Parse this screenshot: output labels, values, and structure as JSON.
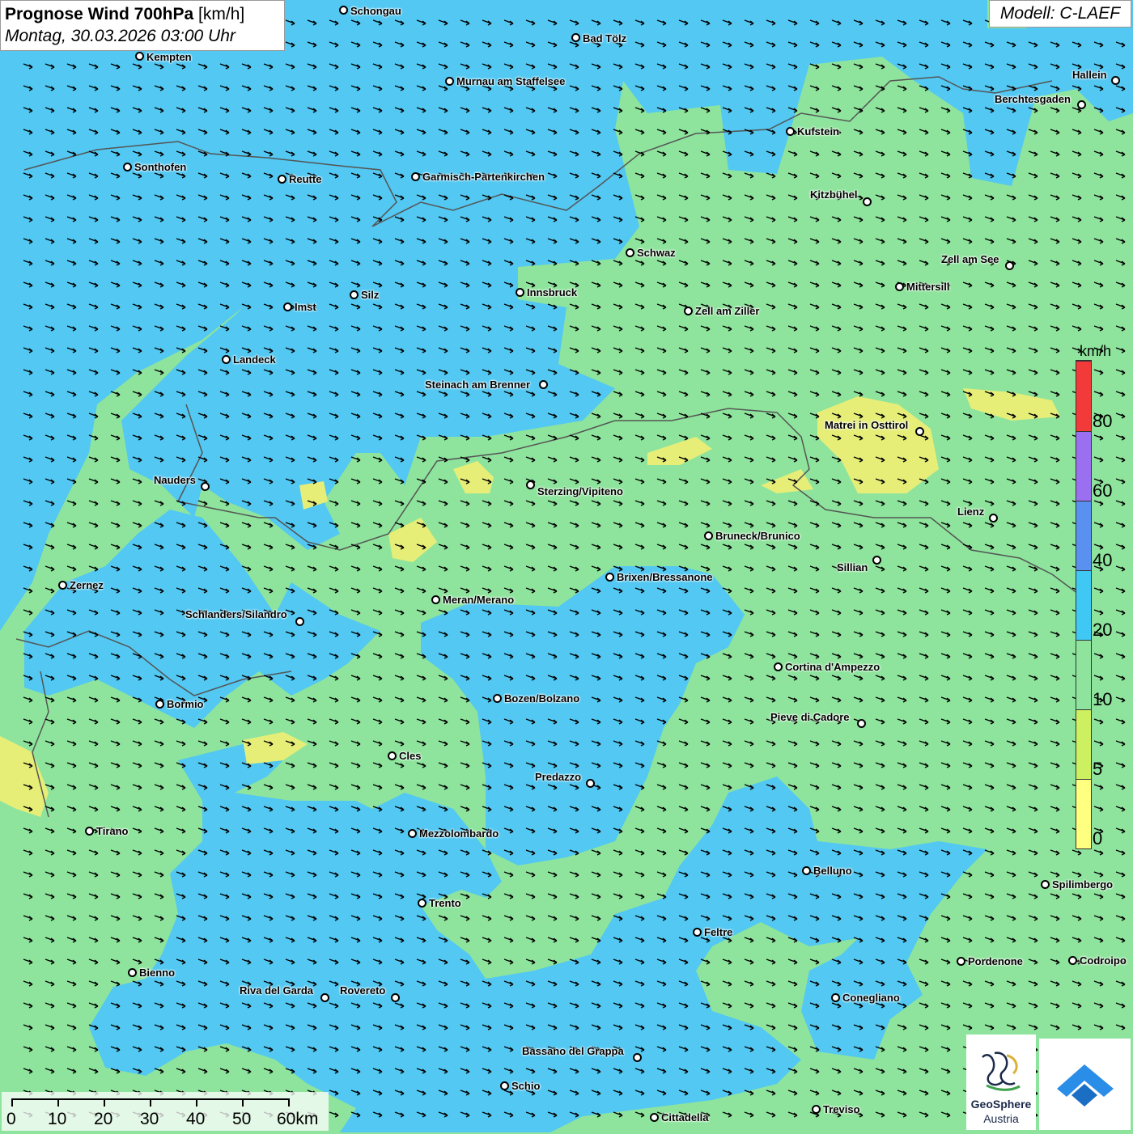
{
  "title": {
    "main": "Prognose Wind 700hPa",
    "unit": "[km/h]",
    "datetime": "Montag, 30.03.2026 03:00 Uhr"
  },
  "model": "Modell: C-LAEF",
  "legend": {
    "unit": "km/h",
    "ticks": [
      "80",
      "60",
      "40",
      "20",
      "10",
      "5",
      "0"
    ],
    "colors": [
      "#ffff80",
      "#ccf060",
      "#8ee49c",
      "#3fc8f4",
      "#5a90f0",
      "#9a70f0",
      "#f23a3a"
    ]
  },
  "scale": {
    "labels": [
      "0",
      "10",
      "20",
      "30",
      "40",
      "50",
      "60km"
    ]
  },
  "logos": {
    "geosphere_line1": "GeoSphere",
    "geosphere_line2": "Austria"
  },
  "cities": [
    {
      "name": "Schongau"
    },
    {
      "name": "Bad Tölz"
    },
    {
      "name": "Kempten"
    },
    {
      "name": "Murnau am Staffelsee"
    },
    {
      "name": "Hallein"
    },
    {
      "name": "Berchtesgaden"
    },
    {
      "name": "Kufstein"
    },
    {
      "name": "Sonthofen"
    },
    {
      "name": "Reutte"
    },
    {
      "name": "Garmisch-Partenkirchen"
    },
    {
      "name": "Kitzbühel"
    },
    {
      "name": "Schwaz"
    },
    {
      "name": "Zell am See"
    },
    {
      "name": "Innsbruck"
    },
    {
      "name": "Mittersill"
    },
    {
      "name": "Silz"
    },
    {
      "name": "Imst"
    },
    {
      "name": "Zell am Ziller"
    },
    {
      "name": "Landeck"
    },
    {
      "name": "Steinach am Brenner"
    },
    {
      "name": "Matrei in Osttirol"
    },
    {
      "name": "Nauders"
    },
    {
      "name": "Sterzing/Vipiteno"
    },
    {
      "name": "Lienz"
    },
    {
      "name": "Bruneck/Brunico"
    },
    {
      "name": "Sillian"
    },
    {
      "name": "Brixen/Bressanone"
    },
    {
      "name": "Zernez"
    },
    {
      "name": "Meran/Merano"
    },
    {
      "name": "Schlanders/Silandro"
    },
    {
      "name": "Cortina d'Ampezzo"
    },
    {
      "name": "Bozen/Bolzano"
    },
    {
      "name": "Bormio"
    },
    {
      "name": "Pieve di Cadore"
    },
    {
      "name": "Cles"
    },
    {
      "name": "Predazzo"
    },
    {
      "name": "Tirano"
    },
    {
      "name": "Mezzolombardo"
    },
    {
      "name": "Belluno"
    },
    {
      "name": "Spilimbergo"
    },
    {
      "name": "Trento"
    },
    {
      "name": "Feltre"
    },
    {
      "name": "Pordenone"
    },
    {
      "name": "Codroipo"
    },
    {
      "name": "Bienno"
    },
    {
      "name": "Riva del Garda"
    },
    {
      "name": "Rovereto"
    },
    {
      "name": "Conegliano"
    },
    {
      "name": "Bassano del Grappa"
    },
    {
      "name": "Schio"
    },
    {
      "name": "Treviso"
    },
    {
      "name": "Cittadella"
    }
  ]
}
